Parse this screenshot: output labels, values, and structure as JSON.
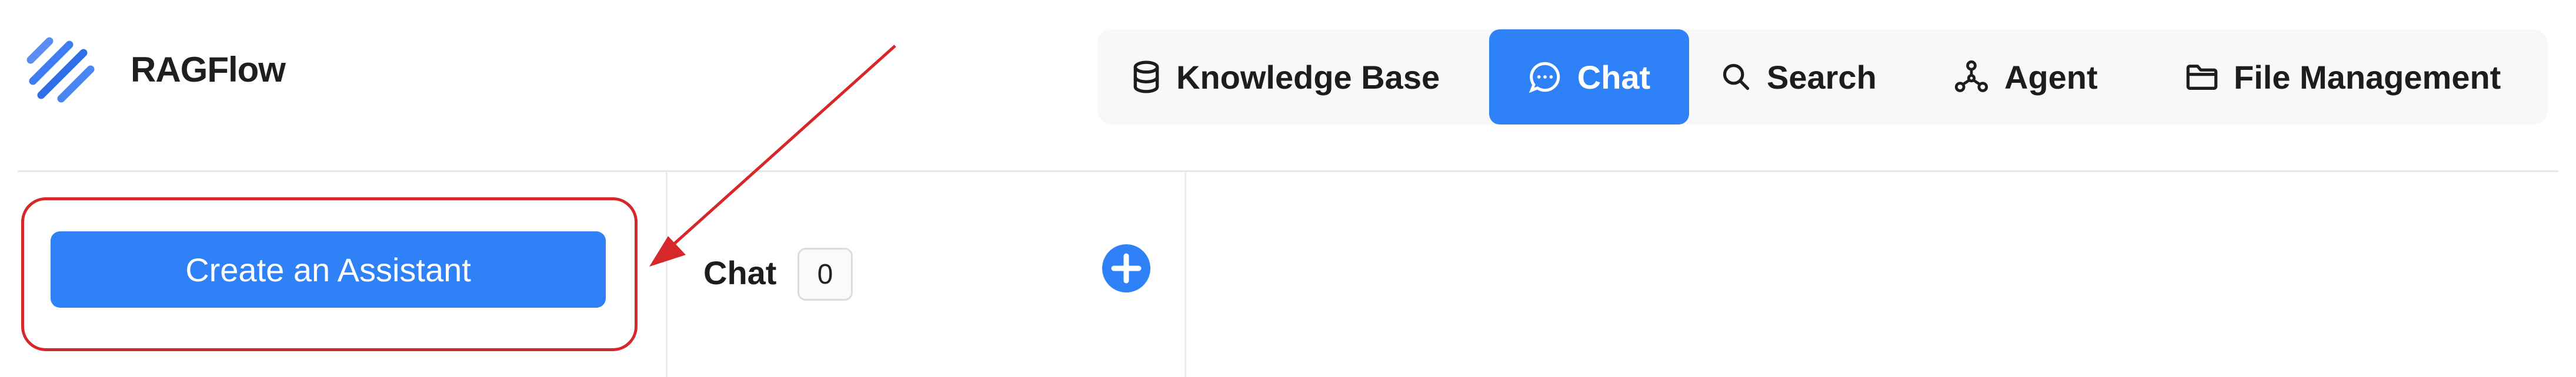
{
  "app": {
    "name": "RAGFlow"
  },
  "nav": {
    "items": [
      {
        "label": "Knowledge Base",
        "icon": "database-icon",
        "active": false
      },
      {
        "label": "Chat",
        "icon": "chat-bubble-icon",
        "active": true
      },
      {
        "label": "Search",
        "icon": "search-icon",
        "active": false
      },
      {
        "label": "Agent",
        "icon": "agent-graph-icon",
        "active": false
      },
      {
        "label": "File Management",
        "icon": "folder-icon",
        "active": false
      }
    ]
  },
  "sidebar": {
    "create_button_label": "Create an Assistant"
  },
  "chat_list": {
    "title": "Chat",
    "count": "0",
    "add_icon": "plus-circle-icon"
  },
  "colors": {
    "accent": "#2f81f7",
    "annotation": "#d6282b",
    "nav_background": "#f7f8fa"
  }
}
